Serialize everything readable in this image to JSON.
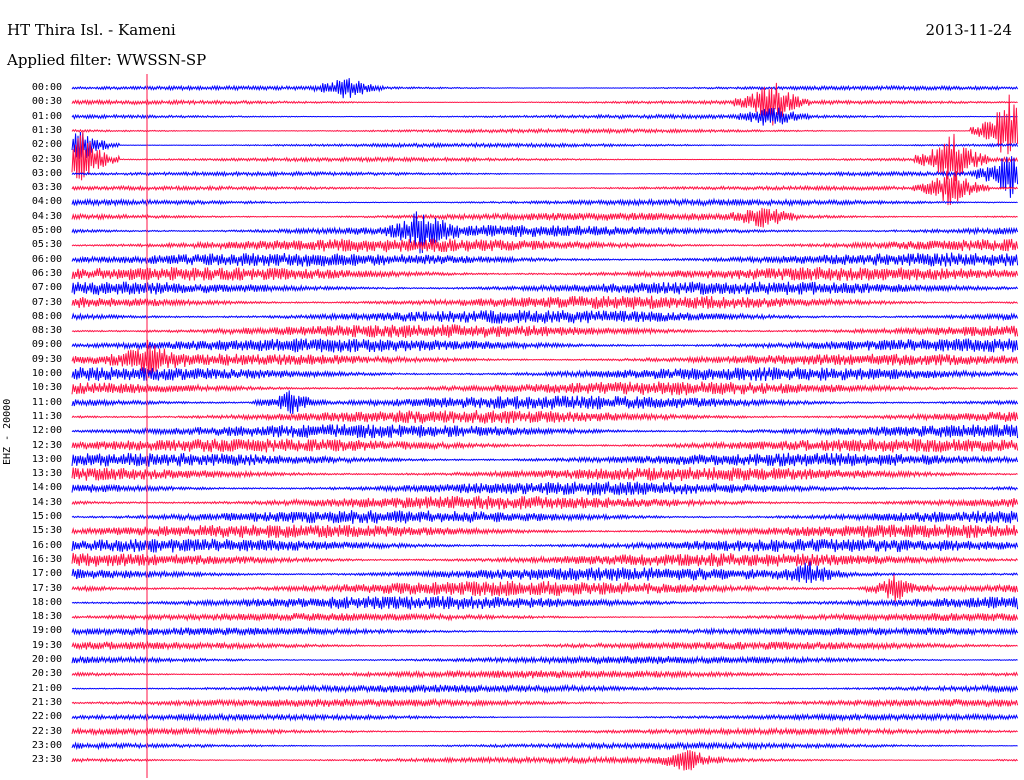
{
  "header": {
    "station": "HT Thira Isl. - Kameni",
    "date": "2013-11-24",
    "filter": "Applied filter: WWSSN-SP"
  },
  "chart_data": {
    "type": "line",
    "ylabel": "EHZ - 20000",
    "tick_labels": [
      "00:00",
      "00:30",
      "01:00",
      "01:30",
      "02:00",
      "02:30",
      "03:00",
      "03:30",
      "04:00",
      "04:30",
      "05:00",
      "05:30",
      "06:00",
      "06:30",
      "07:00",
      "07:30",
      "08:00",
      "08:30",
      "09:00",
      "09:30",
      "10:00",
      "10:30",
      "11:00",
      "11:30",
      "12:00",
      "12:30",
      "13:00",
      "13:30",
      "14:00",
      "14:30",
      "15:00",
      "15:30",
      "16:00",
      "16:30",
      "17:00",
      "17:30",
      "18:00",
      "18:30",
      "19:00",
      "19:30",
      "20:00",
      "20:30",
      "21:00",
      "21:30",
      "22:00",
      "22:30",
      "23:00",
      "23:30"
    ],
    "trace_colors": [
      "#0000ff",
      "#ff1144"
    ],
    "noise_amplitude": [
      2,
      2,
      2,
      2,
      2,
      2,
      2,
      2,
      3,
      4,
      6,
      7,
      7,
      7,
      7,
      7,
      7,
      7,
      7,
      6,
      7,
      7,
      7,
      7,
      7,
      7,
      7,
      7,
      7,
      7,
      7,
      7,
      7,
      7,
      7,
      8,
      7,
      4,
      4,
      4,
      4,
      4,
      4,
      4,
      3,
      3,
      3,
      3
    ],
    "events": [
      {
        "trace": 0,
        "x": 0.29,
        "amp": 14
      },
      {
        "trace": 1,
        "x": 0.74,
        "amp": 24
      },
      {
        "trace": 2,
        "x": 0.74,
        "amp": 14
      },
      {
        "trace": 3,
        "x": 0.99,
        "amp": 40
      },
      {
        "trace": 4,
        "x": 0.01,
        "amp": 18
      },
      {
        "trace": 5,
        "x": 0.01,
        "amp": 30
      },
      {
        "trace": 5,
        "x": 0.93,
        "amp": 30
      },
      {
        "trace": 6,
        "x": 0.99,
        "amp": 26
      },
      {
        "trace": 7,
        "x": 0.93,
        "amp": 22
      },
      {
        "trace": 9,
        "x": 0.73,
        "amp": 14
      },
      {
        "trace": 10,
        "x": 0.37,
        "amp": 22
      },
      {
        "trace": 19,
        "x": 0.08,
        "amp": 16
      },
      {
        "trace": 22,
        "x": 0.23,
        "amp": 14
      },
      {
        "trace": 34,
        "x": 0.78,
        "amp": 12
      },
      {
        "trace": 35,
        "x": 0.87,
        "amp": 14
      },
      {
        "trace": 47,
        "x": 0.65,
        "amp": 12
      }
    ]
  }
}
